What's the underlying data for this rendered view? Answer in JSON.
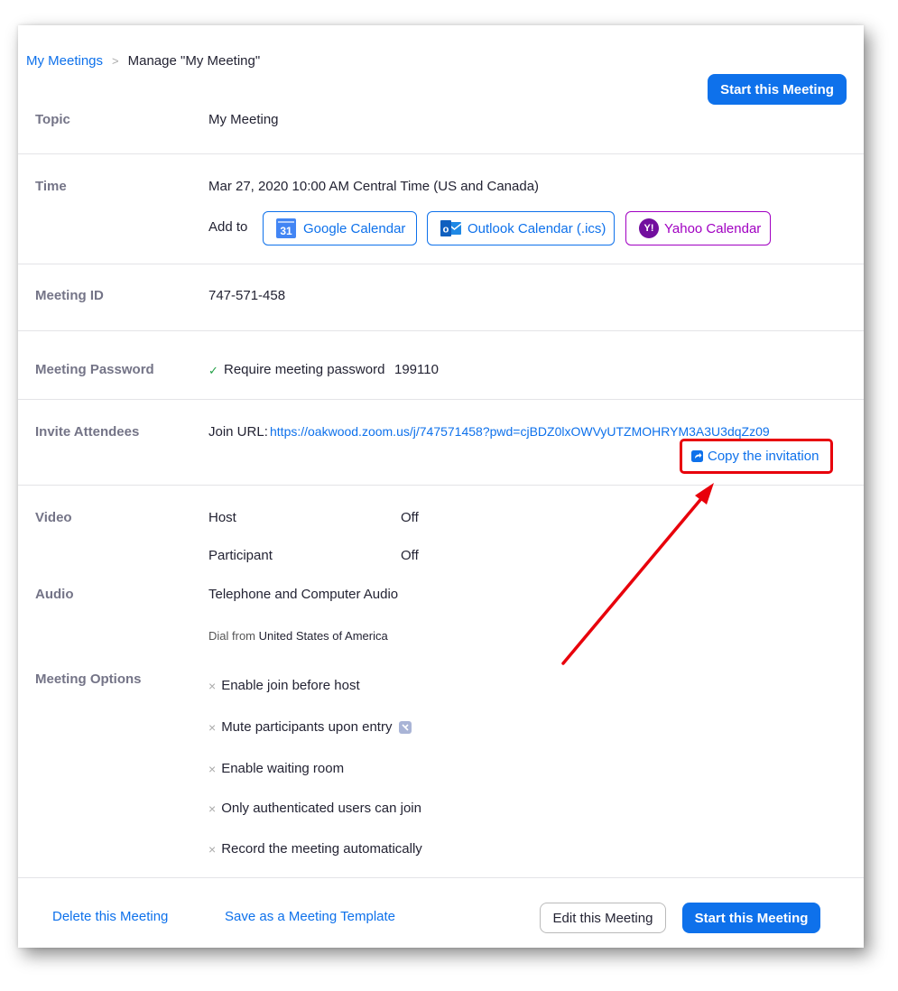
{
  "breadcrumb": {
    "parent": "My Meetings",
    "separator": ">",
    "current": "Manage \"My Meeting\""
  },
  "header": {
    "start_button": "Start this Meeting"
  },
  "topic": {
    "label": "Topic",
    "value": "My Meeting"
  },
  "time": {
    "label": "Time",
    "value": "Mar 27, 2020 10:00 AM Central Time (US and Canada)",
    "add_to_label": "Add to",
    "calendars": [
      {
        "label": "Google Calendar",
        "icon": "google-calendar-icon",
        "icon_text": "31",
        "color": "#0e71eb"
      },
      {
        "label": "Outlook Calendar (.ics)",
        "icon": "outlook-icon",
        "icon_text": "o",
        "color": "#0e71eb"
      },
      {
        "label": "Yahoo Calendar",
        "icon": "yahoo-icon",
        "icon_text": "Y!",
        "color": "#a100c2"
      }
    ]
  },
  "meeting_id": {
    "label": "Meeting ID",
    "value": "747-571-458"
  },
  "password": {
    "label": "Meeting Password",
    "check_icon": "✓",
    "text": "Require meeting password",
    "value": "199110"
  },
  "invite": {
    "label": "Invite Attendees",
    "join_url_label": "Join URL:",
    "join_url": "https://oakwood.zoom.us/j/747571458?pwd=cjBDZ0lxOWVyUTZMOHRYM3A3U3dqZz09",
    "copy_label": "Copy the invitation"
  },
  "video": {
    "label": "Video",
    "host_label": "Host",
    "host_value": "Off",
    "participant_label": "Participant",
    "participant_value": "Off"
  },
  "audio": {
    "label": "Audio",
    "value": "Telephone and Computer Audio",
    "dial_from_label": "Dial from",
    "dial_from_value": "United States of America"
  },
  "options": {
    "label": "Meeting Options",
    "x_icon": "×",
    "items": [
      "Enable join before host",
      "Mute participants upon entry",
      "Enable waiting room",
      "Only authenticated users can join",
      "Record the meeting automatically"
    ]
  },
  "footer": {
    "delete": "Delete this Meeting",
    "save_template": "Save as a Meeting Template",
    "edit": "Edit this Meeting",
    "start": "Start this Meeting"
  },
  "colors": {
    "accent": "#0e71eb",
    "yahoo": "#a100c2",
    "highlight": "#e8000b",
    "check": "#23a047"
  }
}
